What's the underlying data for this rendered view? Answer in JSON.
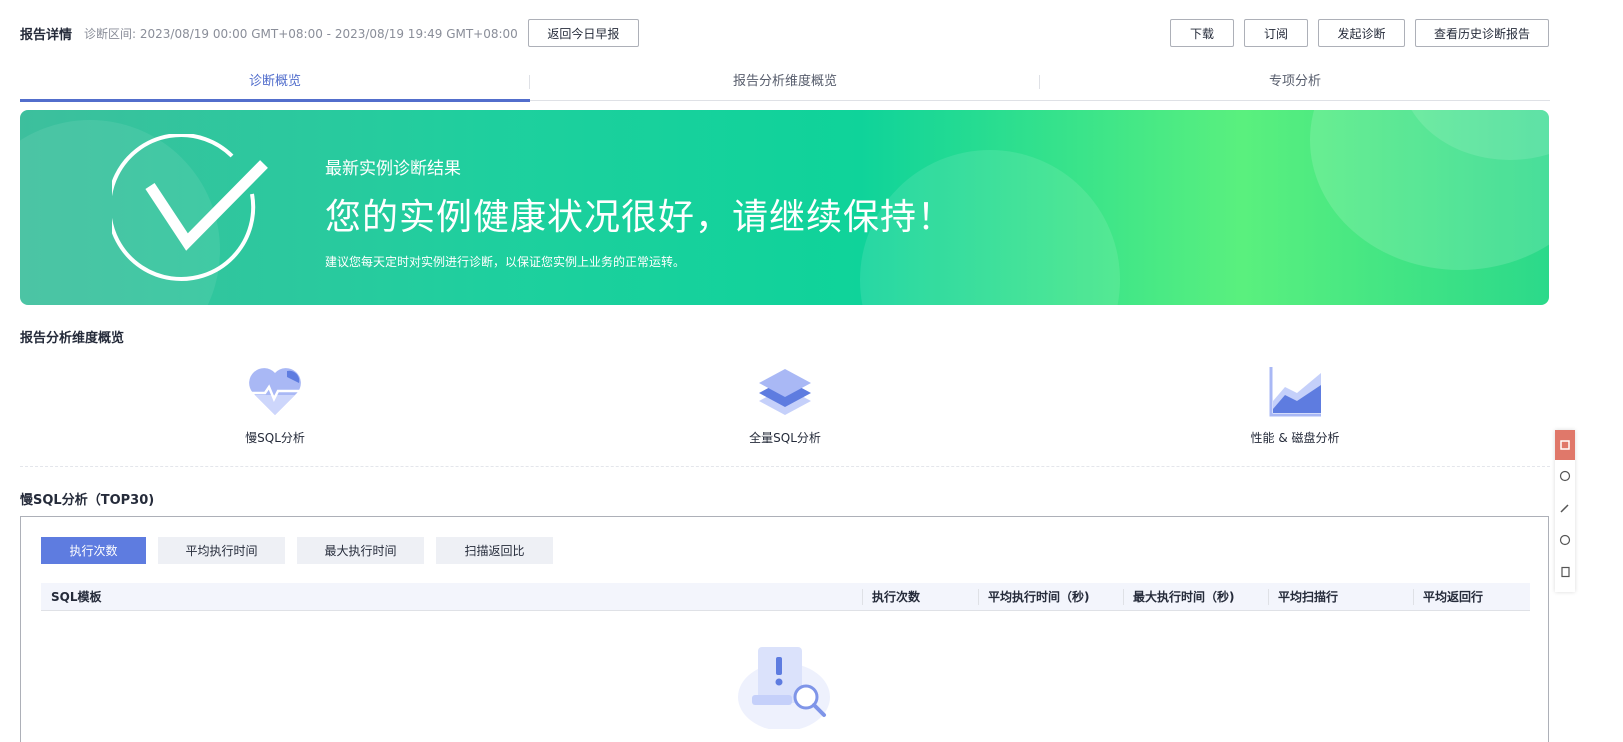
{
  "header": {
    "title": "报告详情",
    "range": "诊断区间: 2023/08/19 00:00 GMT+08:00 - 2023/08/19 19:49 GMT+08:00",
    "back_label": "返回今日早报",
    "actions": [
      "下载",
      "订阅",
      "发起诊断",
      "查看历史诊断报告"
    ]
  },
  "tabs": [
    "诊断概览",
    "报告分析维度概览",
    "专项分析"
  ],
  "banner": {
    "subtitle": "最新实例诊断结果",
    "headline": "您的实例健康状况很好，请继续保持！",
    "hint": "建议您每天定时对实例进行诊断，以保证您实例上业务的正常运转。"
  },
  "dimensions": {
    "title": "报告分析维度概览",
    "items": [
      {
        "label": "慢SQL分析",
        "icon": "heart-pulse-icon"
      },
      {
        "label": "全量SQL分析",
        "icon": "layers-icon"
      },
      {
        "label": "性能 & 磁盘分析",
        "icon": "area-chart-icon"
      }
    ]
  },
  "slow_sql": {
    "title": "慢SQL分析（TOP30)",
    "segments": [
      "执行次数",
      "平均执行时间",
      "最大执行时间",
      "扫描返回比"
    ],
    "active_segment": "执行次数",
    "columns": [
      "SQL模板",
      "执行次数",
      "平均执行时间（秒)",
      "最大执行时间（秒)",
      "平均扫描行",
      "平均返回行"
    ]
  },
  "colors": {
    "accent": "#526ecc",
    "banner_start": "#3dbf9d",
    "banner_end": "#2bd98a",
    "segment_active": "#5e7ce0"
  }
}
